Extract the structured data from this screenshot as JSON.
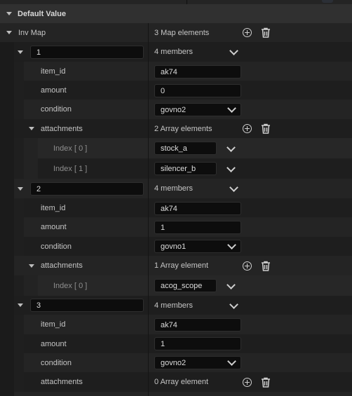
{
  "section": {
    "title": "Default Value"
  },
  "map": {
    "label": "Inv Map",
    "count_text": "3 Map elements",
    "elements": [
      {
        "key": "1",
        "members_text": "4 members",
        "item_id": {
          "label": "item_id",
          "value": "ak74"
        },
        "amount": {
          "label": "amount",
          "value": "0"
        },
        "condition": {
          "label": "condition",
          "value": "govno2"
        },
        "attachments": {
          "label": "attachments",
          "count_text": "2 Array elements",
          "items": [
            {
              "index_label": "Index [ 0 ]",
              "value": "stock_a"
            },
            {
              "index_label": "Index [ 1 ]",
              "value": "silencer_b"
            }
          ]
        }
      },
      {
        "key": "2",
        "members_text": "4 members",
        "item_id": {
          "label": "item_id",
          "value": "ak74"
        },
        "amount": {
          "label": "amount",
          "value": "1"
        },
        "condition": {
          "label": "condition",
          "value": "govno1"
        },
        "attachments": {
          "label": "attachments",
          "count_text": "1 Array element",
          "items": [
            {
              "index_label": "Index [ 0 ]",
              "value": "acog_scope"
            }
          ]
        }
      },
      {
        "key": "3",
        "members_text": "4 members",
        "item_id": {
          "label": "item_id",
          "value": "ak74"
        },
        "amount": {
          "label": "amount",
          "value": "1"
        },
        "condition": {
          "label": "condition",
          "value": "govno2"
        },
        "attachments": {
          "label": "attachments",
          "count_text": "0 Array element",
          "items": []
        }
      }
    ]
  },
  "icons": {
    "expand": "triangle-down-icon",
    "dropdown": "chevron-down-icon",
    "add": "plus-circle-icon",
    "delete": "trash-icon"
  },
  "colors": {
    "background": "#1a1a1a",
    "field": "#0d0d0d",
    "text": "#c8c8c8"
  }
}
